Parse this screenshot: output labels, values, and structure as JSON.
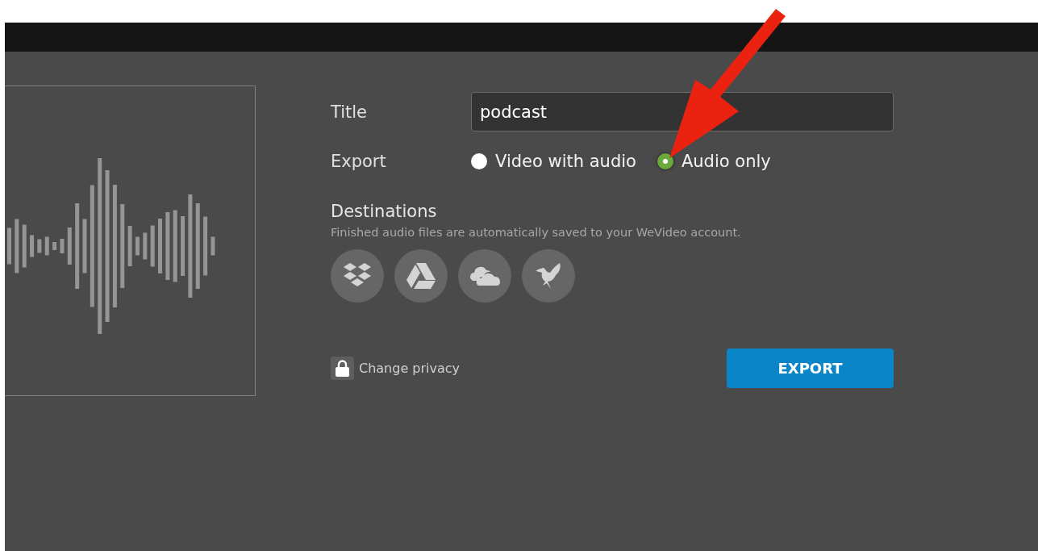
{
  "title_field": {
    "label": "Title",
    "value": "podcast"
  },
  "export": {
    "label": "Export",
    "options": [
      {
        "label": "Video with audio",
        "selected": false
      },
      {
        "label": "Audio only",
        "selected": true
      }
    ]
  },
  "destinations": {
    "heading": "Destinations",
    "note": "Finished audio files are automatically saved to your WeVideo account.",
    "services": [
      {
        "kind": "boxes"
      },
      {
        "kind": "triangle"
      },
      {
        "kind": "cloud"
      },
      {
        "kind": "bird"
      }
    ]
  },
  "privacy": {
    "label": "Change privacy"
  },
  "export_button": {
    "label": "EXPORT"
  }
}
